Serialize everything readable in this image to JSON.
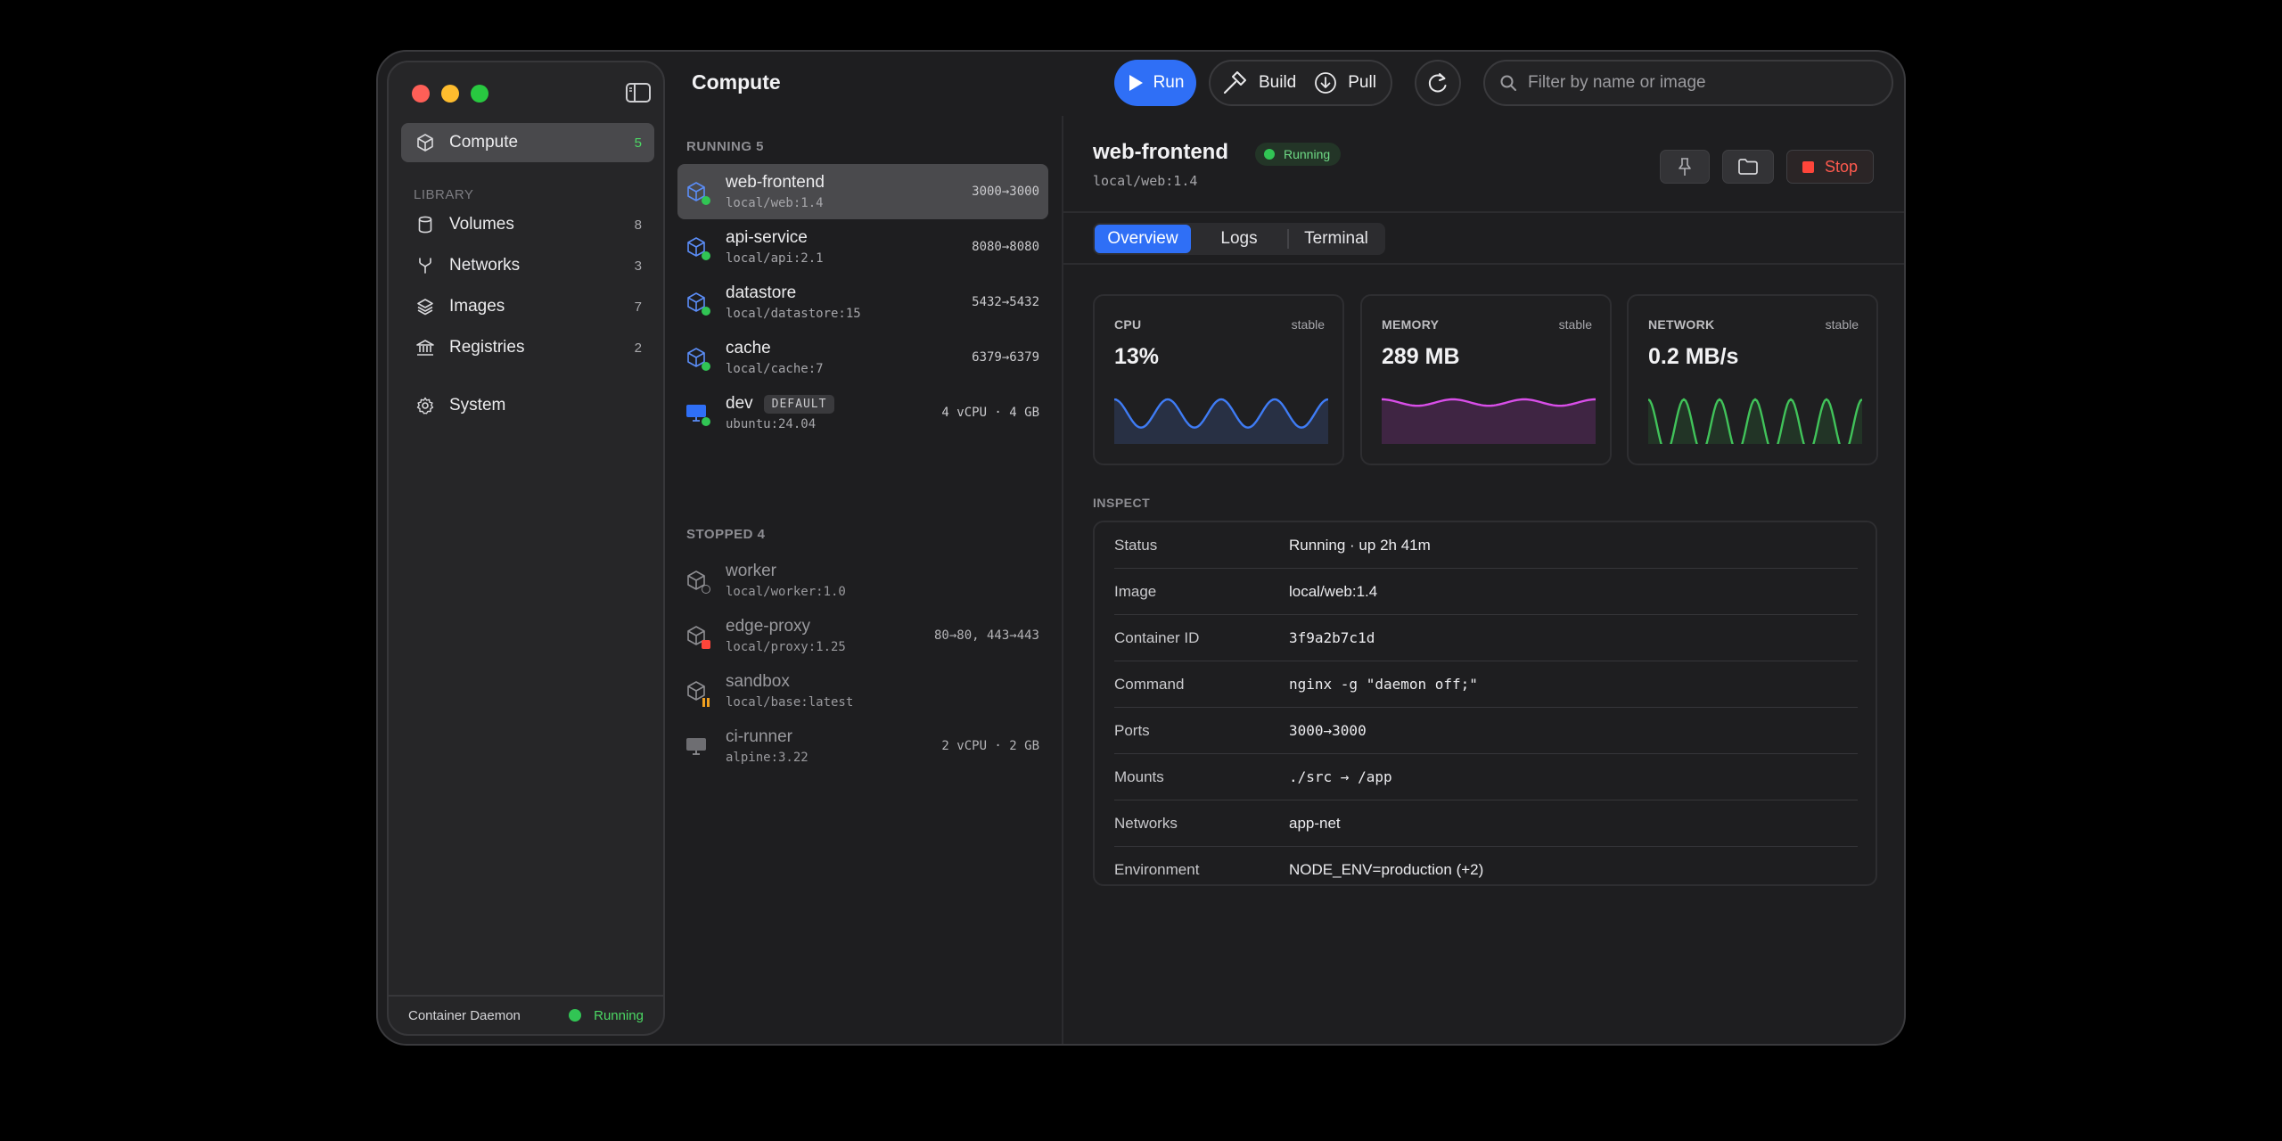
{
  "window": {
    "title": "Compute"
  },
  "sidebar": {
    "items": [
      {
        "label": "Compute",
        "count": "5",
        "icon": "cube-icon"
      }
    ],
    "library_label": "LIBRARY",
    "library": [
      {
        "label": "Volumes",
        "count": "8",
        "icon": "cylinder-icon"
      },
      {
        "label": "Networks",
        "count": "3",
        "icon": "network-fork-icon"
      },
      {
        "label": "Images",
        "count": "7",
        "icon": "layers-icon"
      },
      {
        "label": "Registries",
        "count": "2",
        "icon": "bank-icon"
      }
    ],
    "system": {
      "label": "System",
      "icon": "gear-icon"
    },
    "daemon": {
      "label": "Container Daemon",
      "status": "Running"
    }
  },
  "toolbar": {
    "run_label": "Run",
    "build_label": "Build",
    "pull_label": "Pull",
    "search_placeholder": "Filter by name or image"
  },
  "list": {
    "running_header": "RUNNING 5",
    "stopped_header": "STOPPED 4",
    "running": [
      {
        "name": "web-frontend",
        "image": "local/web:1.4",
        "meta": "3000→3000"
      },
      {
        "name": "api-service",
        "image": "local/api:2.1",
        "meta": "8080→8080"
      },
      {
        "name": "datastore",
        "image": "local/datastore:15",
        "meta": "5432→5432"
      },
      {
        "name": "cache",
        "image": "local/cache:7",
        "meta": "6379→6379"
      },
      {
        "name": "dev",
        "badge": "DEFAULT",
        "image": "ubuntu:24.04",
        "meta": "4 vCPU · 4 GB"
      }
    ],
    "stopped": [
      {
        "name": "worker",
        "image": "local/worker:1.0",
        "meta": ""
      },
      {
        "name": "edge-proxy",
        "image": "local/proxy:1.25",
        "meta": "80→80, 443→443"
      },
      {
        "name": "sandbox",
        "image": "local/base:latest",
        "meta": ""
      },
      {
        "name": "ci-runner",
        "image": "alpine:3.22",
        "meta": "2 vCPU · 2 GB"
      }
    ]
  },
  "detail": {
    "title": "web-frontend",
    "status": "Running",
    "image": "local/web:1.4",
    "stop_label": "Stop",
    "tabs": [
      "Overview",
      "Logs",
      "Terminal"
    ],
    "active_tab": "Overview",
    "stats": [
      {
        "label": "CPU",
        "trend": "stable",
        "value": "13%",
        "color": "#3f7cf5"
      },
      {
        "label": "MEMORY",
        "trend": "stable",
        "value": "289 MB",
        "color": "#d84ee8"
      },
      {
        "label": "NETWORK",
        "trend": "stable",
        "value": "0.2 MB/s",
        "color": "#41c35a"
      }
    ],
    "inspect_label": "INSPECT",
    "inspect": [
      {
        "key": "Status",
        "value": "Running · up 2h 41m",
        "mono": false
      },
      {
        "key": "Image",
        "value": "local/web:1.4",
        "mono": false
      },
      {
        "key": "Container ID",
        "value": "3f9a2b7c1d",
        "mono": true
      },
      {
        "key": "Command",
        "value": "nginx -g \"daemon off;\"",
        "mono": true
      },
      {
        "key": "Ports",
        "value": "3000→3000",
        "mono": true
      },
      {
        "key": "Mounts",
        "value": "./src → /app",
        "mono": true
      },
      {
        "key": "Networks",
        "value": "app-net",
        "mono": false
      },
      {
        "key": "Environment",
        "value": "NODE_ENV=production (+2)",
        "mono": false
      }
    ]
  }
}
